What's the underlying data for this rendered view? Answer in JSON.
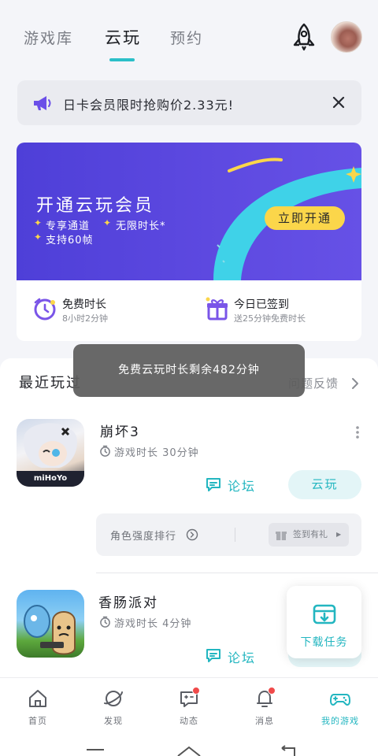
{
  "tabs": [
    {
      "label": "游戏库",
      "active": false
    },
    {
      "label": "云玩",
      "active": true
    },
    {
      "label": "预约",
      "active": false
    }
  ],
  "notice": {
    "text": "日卡会员限时抢购价2.33元!"
  },
  "membership": {
    "title": "开通云玩会员",
    "perks": [
      "专享通道",
      "无限时长*",
      "支持60帧"
    ],
    "button_label": "立即开通",
    "free_time": {
      "title": "免费时长",
      "detail": "8小时2分钟"
    },
    "checkin": {
      "title": "今日已签到",
      "detail": "送25分钟免费时长"
    }
  },
  "toast": {
    "text": "免费云玩时长剩余482分钟"
  },
  "recent": {
    "title": "最近玩过",
    "feedback_label": "问题反馈",
    "games": [
      {
        "name": "崩坏3",
        "playtime": "游戏时长 30分钟",
        "forum_label": "论坛",
        "play_label": "云玩",
        "icon_text": "miHoYo",
        "extra": {
          "label": "角色强度排行",
          "pill": "签到有礼"
        }
      },
      {
        "name": "香肠派对",
        "playtime": "游戏时长 4分钟",
        "forum_label": "论坛"
      }
    ]
  },
  "download_task": {
    "label": "下载任务"
  },
  "bottom_nav": [
    {
      "label": "首页",
      "icon": "home-icon",
      "badge": false,
      "active": false
    },
    {
      "label": "发现",
      "icon": "planet-icon",
      "badge": false,
      "active": false
    },
    {
      "label": "动态",
      "icon": "chat-icon",
      "badge": true,
      "active": false
    },
    {
      "label": "消息",
      "icon": "bell-icon",
      "badge": true,
      "active": false
    },
    {
      "label": "我的游戏",
      "icon": "gamepad-icon",
      "badge": false,
      "active": true
    }
  ],
  "colors": {
    "accent": "#23b6c0",
    "banner": "#5644dc",
    "button_yellow": "#fbd64a",
    "badge_red": "#f04a4a"
  }
}
